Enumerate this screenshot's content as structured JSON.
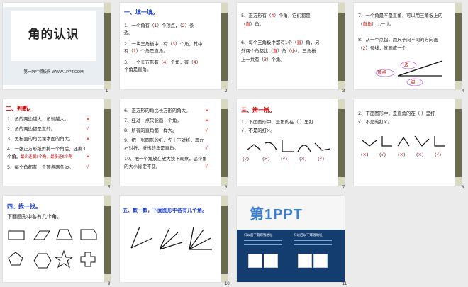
{
  "slides": [
    {
      "num": "1",
      "title": "角的认识",
      "footer": "第一PPT模板网-WWW.1PPT.COM"
    },
    {
      "num": "2",
      "heading": "一、填一填。",
      "l1a": "1、一个角有（",
      "l1b": "1",
      "l1c": "）个顶点，（",
      "l1d": "2",
      "l1e": "）条",
      "l1f": "边。",
      "l2a": "2、一块三角板中，有（",
      "l2b": "3",
      "l2c": "）个角，其中",
      "l2d": "有（",
      "l2e": "1",
      "l2f": "）个角是直角。",
      "l3a": "3、一个长方形有（",
      "l3b": "4",
      "l3c": "）个角，有（",
      "l3d": "4",
      "l3e": "）",
      "l3f": "个角是直角。"
    },
    {
      "num": "3",
      "l1a": "5、正方形有（",
      "l1b": "4",
      "l1c": "）个角，它们都是",
      "l1d": "（",
      "l1e": "直",
      "l1f": "）角。",
      "l2a": "6、每个三角板中都有1个（",
      "l2b": "直",
      "l2c": "）角，另",
      "l2d": "外两个角都比（",
      "l2e": "直",
      "l2f": "）角（",
      "l2g": "小",
      "l2h": "）。三角板",
      "l2i": "上一共有（",
      "l2j": "3",
      "l2k": "）个角。"
    },
    {
      "num": "4",
      "l1a": "7、一个角是不是直角，可以用三角板上的",
      "l1b": "（",
      "l1c": "直角",
      "l1d": "）比一比。",
      "l2a": "8、从一个点起，用尺子向不同的方向画",
      "l2b": "（",
      "l2c": "2",
      "l2d": "）条线，就画成一个",
      "edge": "边",
      "vertex": "顶点"
    },
    {
      "num": "5",
      "heading": "二、判断。",
      "rows": [
        {
          "text": "1、角的两边越大，角就越大。",
          "mark": "×"
        },
        {
          "text": "2、角的两边都是直的。",
          "mark": "√"
        },
        {
          "text": "3、黑板面的角比课本面的角大。",
          "mark": "×"
        },
        {
          "text": "4、一张正方形纸剪掉一个角后，还剩3",
          "text2": "个角。",
          "note": "最少还剩3个角，最多还5个角",
          "mark": "×"
        },
        {
          "text": "5、每个角都有一个顶点两条边。",
          "mark": "√"
        }
      ]
    },
    {
      "num": "6",
      "rows": [
        {
          "text": "6、正方形的角比长方形的角大。",
          "mark": "×"
        },
        {
          "text": "7、经过一点只能画一个角。",
          "mark": "×"
        },
        {
          "text": "8、所有的直角都一样大。",
          "mark": "√"
        },
        {
          "text": "9、把一张圆形的纸，先上下对折，再左",
          "text2": "右对折，折出的角是直角。",
          "mark": "√"
        },
        {
          "text": "10、把一个角放在放大镜下观察，这个角",
          "text2": "的大小肯定不变。",
          "mark": "√"
        }
      ]
    },
    {
      "num": "7",
      "heading": "三、辨一辨。",
      "q1": "1、下面图形中，是角的在（   ）里打",
      "q2": "√，不是的打×。",
      "marks": [
        "√",
        "×",
        "√",
        "×",
        "√"
      ]
    },
    {
      "num": "8",
      "q1": "2、下面图形中，是直角的在（   ）里打",
      "q2": "√，不是的打×。",
      "marks": [
        "×",
        "√",
        "×",
        "×",
        "√"
      ]
    },
    {
      "num": "9",
      "heading": "四、找一找。",
      "q": "下面图形中各有几个角。"
    },
    {
      "num": "10",
      "heading": "五、数一数，下面图形中各有几个角。"
    },
    {
      "num": "11",
      "logo": "第1PPT",
      "col1": "扫以后下载赚钱地址",
      "col2": "扫以后以下赚钱地址"
    }
  ]
}
